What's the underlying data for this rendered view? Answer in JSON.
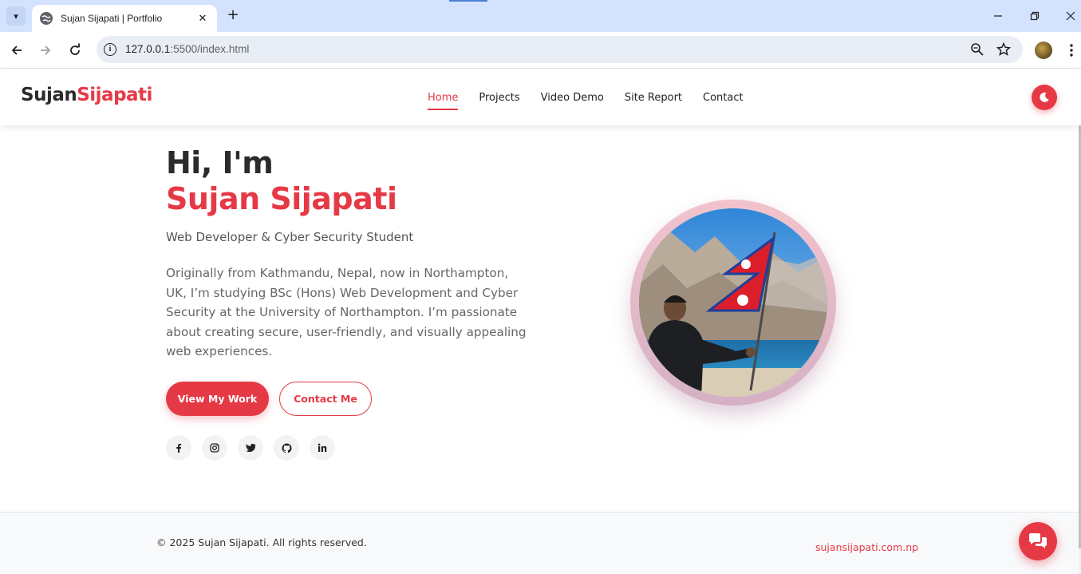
{
  "browser": {
    "tab_title": "Sujan Sijapati | Portfolio",
    "tab_close": "✕",
    "new_tab": "+",
    "url_host": "127.0.0.1",
    "url_rest": ":5500/index.html",
    "window_controls": [
      "minimize-icon",
      "restore-icon",
      "close-icon"
    ]
  },
  "site": {
    "logo_first": "Sujan",
    "logo_last": "Sijapati",
    "nav": [
      {
        "label": "Home",
        "active": true
      },
      {
        "label": "Projects",
        "active": false
      },
      {
        "label": "Video Demo",
        "active": false
      },
      {
        "label": "Site Report",
        "active": false
      },
      {
        "label": "Contact",
        "active": false
      }
    ],
    "accent_color": "#e63946"
  },
  "hero": {
    "greeting": "Hi, I'm",
    "name": "Sujan Sijapati",
    "role": "Web Developer & Cyber Security Student",
    "bio": "Originally from Kathmandu, Nepal, now in Northampton, UK, I’m studying BSc (Hons) Web Development and Cyber Security at the University of Northampton. I’m passionate about creating secure, user-friendly, and visually appealing web experiences.",
    "primary_button": "View My Work",
    "secondary_button": "Contact Me",
    "socials": [
      "facebook-icon",
      "instagram-icon",
      "twitter-icon",
      "github-icon",
      "linkedin-icon"
    ]
  },
  "footer": {
    "copyright": "© 2025 Sujan Sijapati. All rights reserved.",
    "link": "sujansijapati.com.np"
  }
}
